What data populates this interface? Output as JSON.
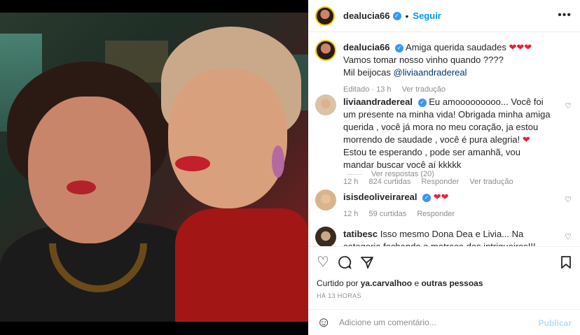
{
  "header": {
    "username": "dealucia66",
    "follow_label": "Seguir",
    "more_icon": "more-horizontal-icon"
  },
  "caption": {
    "username": "dealucia66",
    "line1": "Amiga querida saudades",
    "hearts": "❤❤❤",
    "line2": "Vamos tomar nosso vinho quando ????",
    "line3_prefix": "Mil beijocas",
    "mention": "@liviaandradereal",
    "edited": "Editado · 13 h",
    "translate": "Ver tradução"
  },
  "comments": [
    {
      "username": "liviaandradereal",
      "text_before": "Eu amooooooooo... Você foi um presente na minha vida! Obrigada minha amiga querida , você já mora no meu coração, ja estou morrendo de saudade , você é pura alegria!",
      "heart": "❤",
      "text_after": "Estou te esperando , pode ser amanhã, vou mandar buscar você aí kkkkk",
      "time": "12 h",
      "likes": "824 curtidas",
      "reply": "Responder",
      "translate": "Ver tradução",
      "replies": "Ver respostas (20)"
    },
    {
      "username": "isisdeoliveirareal",
      "hearts": "❤❤",
      "time": "12 h",
      "likes": "59 curtidas",
      "reply": "Responder"
    },
    {
      "username": "tatibesc",
      "text": "Isso mesmo Dona Dea e Livia... Na categoria fechando a matraca dos intriqueiros!!! Bom vinho para vcs"
    }
  ],
  "actions": {
    "like_icon": "heart-outline-icon",
    "comment_icon": "comment-icon",
    "share_icon": "send-icon",
    "save_icon": "bookmark-icon"
  },
  "liked_by": {
    "prefix": "Curtido por",
    "user": "ya.carvalhoo",
    "middle": "e",
    "others": "outras pessoas"
  },
  "timestamp": "HÁ 13 HORAS",
  "add_comment": {
    "placeholder": "Adicione um comentário...",
    "publish": "Publicar"
  },
  "colors": {
    "accent": "#0095f6",
    "heart": "#ed1e3a",
    "mention": "#00376b",
    "muted": "#8e8e8e"
  }
}
